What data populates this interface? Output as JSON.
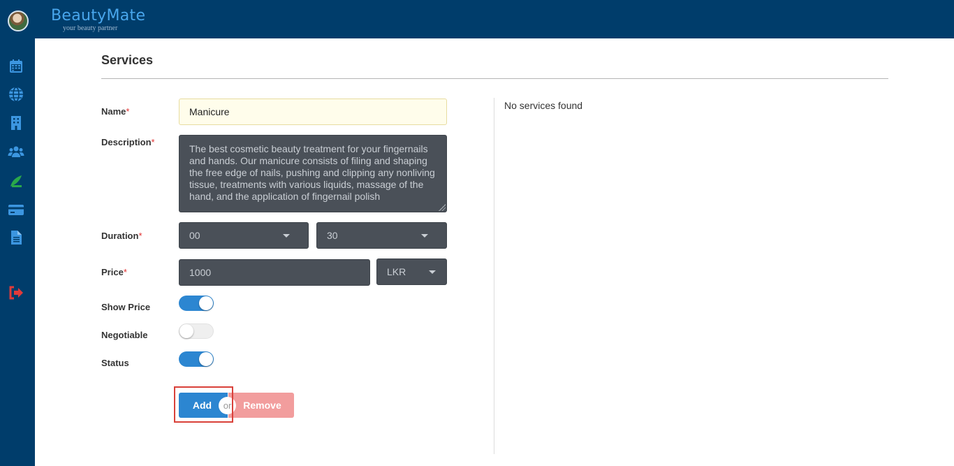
{
  "header": {
    "brand_name": "BeautyMate",
    "brand_tagline": "your beauty partner"
  },
  "sidebar": {
    "items": [
      {
        "icon": "calendar-icon"
      },
      {
        "icon": "globe-icon"
      },
      {
        "icon": "building-icon"
      },
      {
        "icon": "users-icon"
      },
      {
        "icon": "services-icon"
      },
      {
        "icon": "credit-card-icon"
      },
      {
        "icon": "document-icon"
      },
      {
        "icon": "logout-icon"
      }
    ]
  },
  "page": {
    "title": "Services",
    "empty_message": "No services found"
  },
  "form": {
    "name_label": "Name",
    "name_value": "Manicure",
    "description_label": "Description",
    "description_value": "The best cosmetic beauty treatment for your fingernails and hands. Our manicure consists of filing and shaping the free edge of nails, pushing and clipping any nonliving tissue, treatments with various liquids, massage of the hand, and the application of fingernail polish",
    "duration_label": "Duration",
    "duration_hours": "00",
    "duration_minutes": "30",
    "price_label": "Price",
    "price_value": "1000",
    "currency": "LKR",
    "show_price_label": "Show Price",
    "show_price_on": true,
    "negotiable_label": "Negotiable",
    "negotiable_on": false,
    "status_label": "Status",
    "status_on": true,
    "required_mark": "*"
  },
  "actions": {
    "add_label": "Add",
    "or_label": "or",
    "remove_label": "Remove"
  },
  "colors": {
    "header_bg": "#003d6b",
    "primary": "#2c86d1",
    "danger_light": "#f29d9d",
    "logout": "#e03a3a",
    "services_icon": "#2aa84a"
  }
}
